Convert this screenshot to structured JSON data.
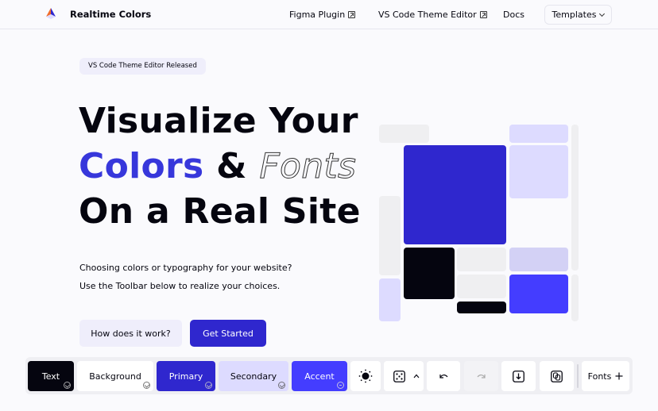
{
  "nav": {
    "brand": "Realtime Colors",
    "links": [
      {
        "label": "Figma Plugin",
        "external": true
      },
      {
        "label": "VS Code Theme Editor",
        "external": true
      },
      {
        "label": "Docs",
        "external": false
      }
    ],
    "templates_label": "Templates"
  },
  "hero": {
    "badge": "VS Code Theme Editor Released",
    "headline_line1": "Visualize Your",
    "headline_colors": "Colors",
    "headline_amp": "&",
    "headline_fonts": "Fonts",
    "headline_line3": "On a Real Site",
    "subtitle_line1": "Choosing colors or typography for your website?",
    "subtitle_line2": "Use the Toolbar below to realize your choices.",
    "secondary_button": "How does it work?",
    "primary_button": "Get Started"
  },
  "colors": {
    "text": "#05050f",
    "background": "#fafafd",
    "primary": "#2f27ce",
    "secondary": "#dddbff",
    "accent": "#443dff"
  },
  "toolbar": {
    "swatches": [
      {
        "label": "Text",
        "status": "check"
      },
      {
        "label": "Background",
        "status": "check"
      },
      {
        "label": "Primary",
        "status": "check"
      },
      {
        "label": "Secondary",
        "status": "check"
      },
      {
        "label": "Accent",
        "status": "minus"
      }
    ],
    "icons": {
      "theme": "sun-icon",
      "randomize": "dice-icon",
      "expand": "chevron-up-icon",
      "undo": "undo-icon",
      "redo": "redo-icon",
      "export": "download-icon",
      "share": "copy-link-icon"
    },
    "fonts_label": "Fonts",
    "fonts_icon": "plus-icon"
  }
}
